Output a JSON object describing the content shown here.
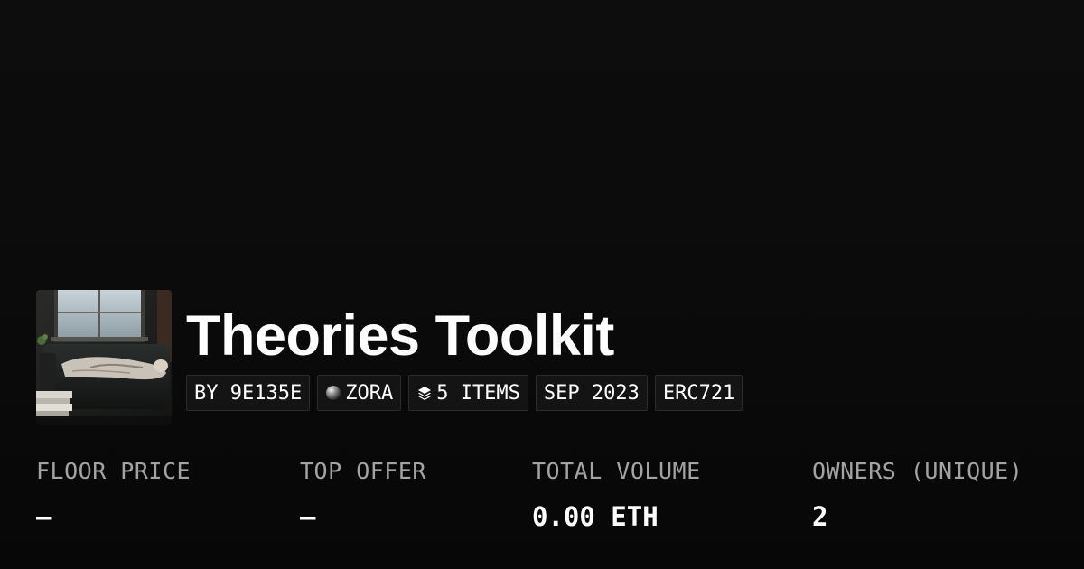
{
  "collection": {
    "title": "Theories Toolkit",
    "cover_image": "cover-image-person-lying-on-couch-by-window",
    "tags": {
      "creator": "BY 9E135E",
      "chain": "ZORA",
      "chain_icon": "zora-orb-icon",
      "items": "5 ITEMS",
      "items_icon": "layers-icon",
      "date": "SEP 2023",
      "standard": "ERC721"
    }
  },
  "stats": {
    "floor_price": {
      "label": "FLOOR PRICE",
      "value": "—"
    },
    "top_offer": {
      "label": "TOP OFFER",
      "value": "—"
    },
    "total_volume": {
      "label": "TOTAL VOLUME",
      "value": "0.00 ETH"
    },
    "owners": {
      "label": "OWNERS (UNIQUE)",
      "value": "2"
    }
  },
  "colors": {
    "background": "#0b0b0b",
    "tag_background": "#141414",
    "tag_border": "#2b2b2b",
    "label": "#a3a3a3",
    "text": "#ffffff"
  }
}
